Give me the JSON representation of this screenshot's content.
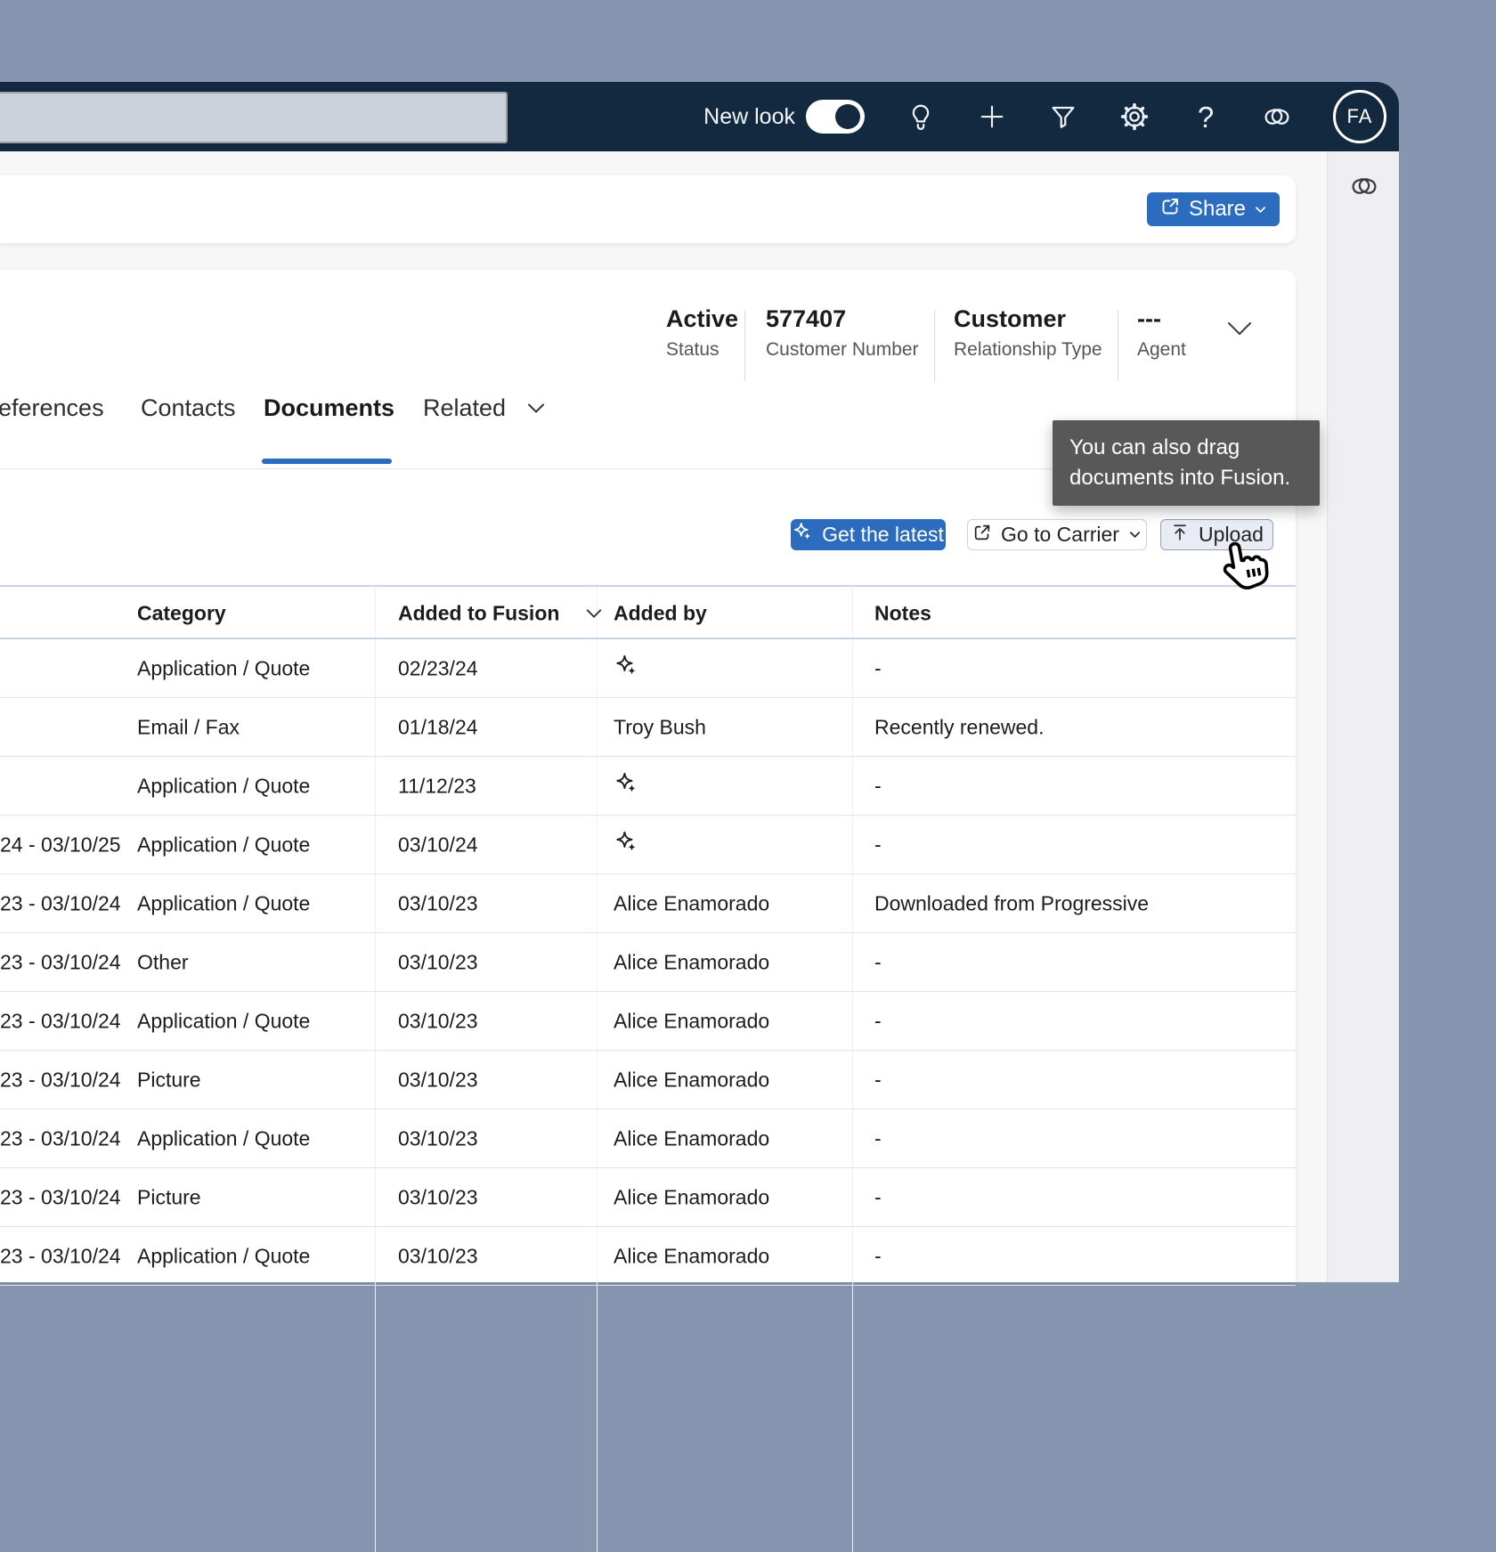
{
  "colors": {
    "outer_bg": "#8695b0",
    "topbar_bg": "#13293f",
    "accent_blue": "#2b6cbf",
    "tooltip_bg": "#585858",
    "page_bg": "#f7f7f8",
    "table_line": "#c9d3e7",
    "row_line": "#e0e4ee"
  },
  "topbar": {
    "new_look_label": "New look",
    "new_look_on": true,
    "avatar_initials": "FA",
    "icons": [
      "lightbulb-icon",
      "add-icon",
      "filter-icon",
      "settings-icon",
      "help-icon",
      "copilot-icon"
    ]
  },
  "share": {
    "label": "Share"
  },
  "summary": {
    "fields": [
      {
        "value": "Active",
        "label": "Status"
      },
      {
        "value": "577407",
        "label": "Customer Number"
      },
      {
        "value": "Customer",
        "label": "Relationship Type"
      },
      {
        "value": "---",
        "label": "Agent"
      }
    ]
  },
  "tabs": {
    "items": [
      {
        "label": "eferences",
        "active": false
      },
      {
        "label": "Contacts",
        "active": false
      },
      {
        "label": "Documents",
        "active": true
      },
      {
        "label": "Related",
        "active": false,
        "has_dropdown": true
      }
    ]
  },
  "tooltip": {
    "text": "You can also drag documents into Fusion."
  },
  "actions": {
    "get_latest": "Get the latest",
    "go_to_carrier": "Go to Carrier",
    "upload": "Upload"
  },
  "table": {
    "columns": [
      "Category",
      "Added to Fusion",
      "Added by",
      "Notes"
    ],
    "sort_column": "Added to Fusion",
    "rows": [
      {
        "term": "",
        "category": "Application / Quote",
        "added": "02/23/24",
        "added_by": "",
        "ai": true,
        "notes": "-"
      },
      {
        "term": "",
        "category": "Email / Fax",
        "added": "01/18/24",
        "added_by": "Troy Bush",
        "ai": false,
        "notes": "Recently renewed."
      },
      {
        "term": "",
        "category": "Application / Quote",
        "added": "11/12/23",
        "added_by": "",
        "ai": true,
        "notes": "-"
      },
      {
        "term": "24 - 03/10/25",
        "category": "Application / Quote",
        "added": "03/10/24",
        "added_by": "",
        "ai": true,
        "notes": "-"
      },
      {
        "term": "23 - 03/10/24",
        "category": "Application / Quote",
        "added": "03/10/23",
        "added_by": "Alice Enamorado",
        "ai": false,
        "notes": "Downloaded from Progressive"
      },
      {
        "term": "23 - 03/10/24",
        "category": "Other",
        "added": "03/10/23",
        "added_by": "Alice Enamorado",
        "ai": false,
        "notes": "-"
      },
      {
        "term": "23 - 03/10/24",
        "category": "Application / Quote",
        "added": "03/10/23",
        "added_by": "Alice Enamorado",
        "ai": false,
        "notes": "-"
      },
      {
        "term": "23 - 03/10/24",
        "category": "Picture",
        "added": "03/10/23",
        "added_by": "Alice Enamorado",
        "ai": false,
        "notes": "-"
      },
      {
        "term": "23 - 03/10/24",
        "category": "Application / Quote",
        "added": "03/10/23",
        "added_by": "Alice Enamorado",
        "ai": false,
        "notes": "-"
      },
      {
        "term": "23 - 03/10/24",
        "category": "Picture",
        "added": "03/10/23",
        "added_by": "Alice Enamorado",
        "ai": false,
        "notes": "-"
      },
      {
        "term": "23 - 03/10/24",
        "category": "Application / Quote",
        "added": "03/10/23",
        "added_by": "Alice Enamorado",
        "ai": false,
        "notes": "-"
      }
    ]
  }
}
